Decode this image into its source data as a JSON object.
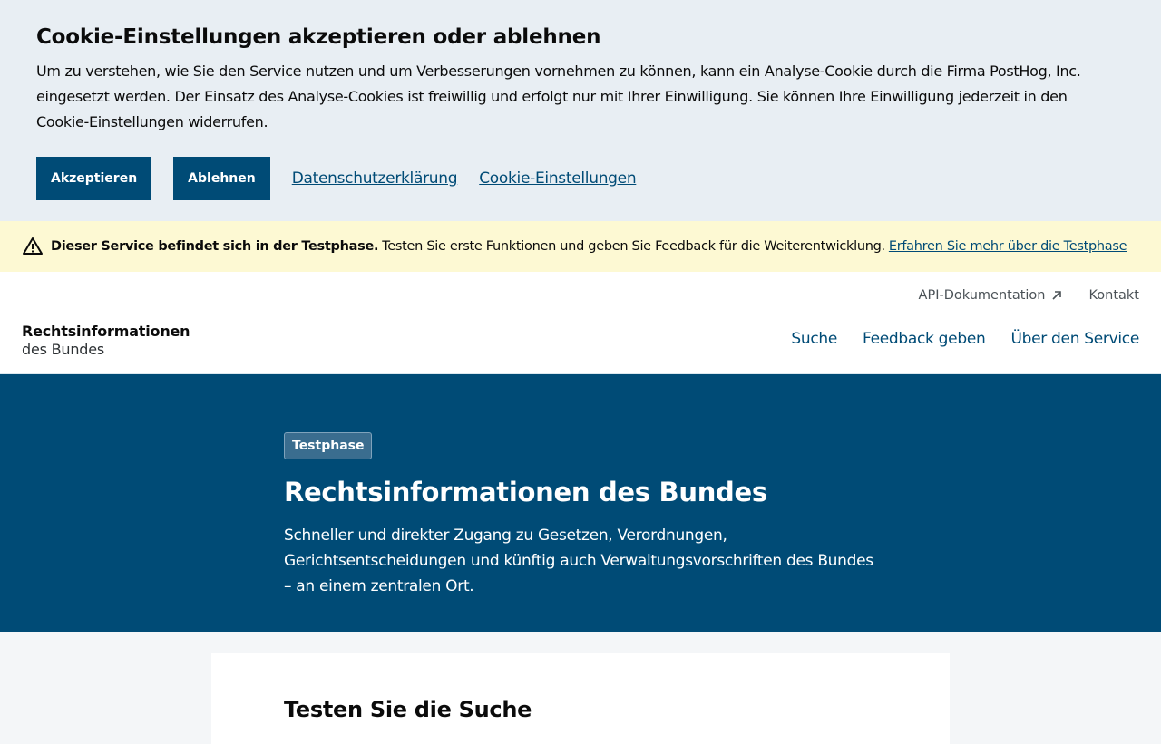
{
  "cookie_banner": {
    "title": "Cookie-Einstellungen akzeptieren oder ablehnen",
    "text": "Um zu verstehen, wie Sie den Service nutzen und um Verbesserungen vornehmen zu können, kann ein Analyse-Cookie durch die Firma PostHog, Inc. eingesetzt werden. Der Einsatz des Analyse-Cookies ist freiwillig und erfolgt nur mit Ihrer Einwilligung. Sie können Ihre Einwilligung jederzeit in den Cookie-Einstellungen widerrufen.",
    "accept_label": "Akzeptieren",
    "reject_label": "Ablehnen",
    "privacy_link": "Datenschutzerklärung",
    "settings_link": "Cookie-Einstellungen"
  },
  "notice": {
    "icon": "warning-icon",
    "bold": "Dieser Service befindet sich in der Testphase.",
    "text": "Testen Sie erste Funktionen und geben Sie Feedback für die Weiterentwicklung.",
    "link": "Erfahren Sie mehr über die Testphase"
  },
  "header": {
    "brand_line1": "Rechtsinformationen",
    "brand_line2": "des Bundes",
    "meta_links": {
      "api": "API-Dokumentation",
      "contact": "Kontakt"
    },
    "nav": {
      "search": "Suche",
      "feedback": "Feedback geben",
      "about": "Über den Service"
    }
  },
  "hero": {
    "badge": "Testphase",
    "title": "Rechtsinformationen des Bundes",
    "text": "Schneller und direkter Zugang zu Gesetzen, Verordnungen, Gerichtsentscheidungen und künftig auch Verwaltungsvorschriften des Bundes – an einem zentralen Ort."
  },
  "card": {
    "title": "Testen Sie die Suche"
  },
  "colors": {
    "primary": "#004b76",
    "cookie_bg": "#e8eef3",
    "notice_bg": "#fdf9d3"
  }
}
